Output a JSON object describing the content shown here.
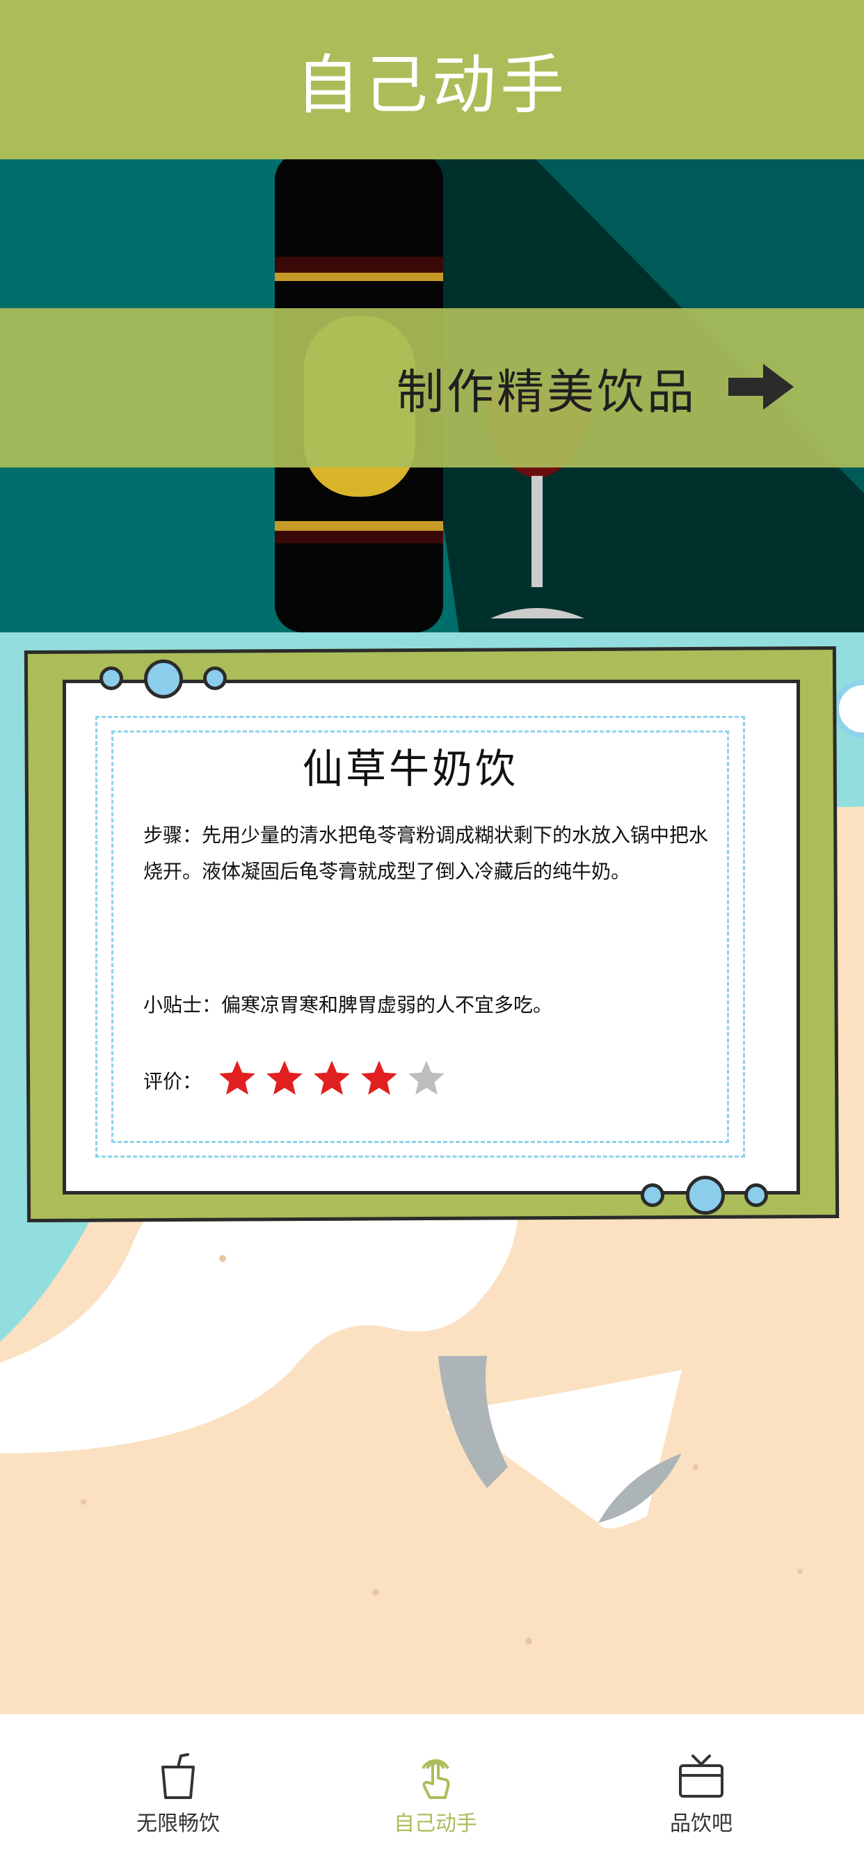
{
  "header": {
    "title": "自己动手"
  },
  "hero": {
    "text": "制作精美饮品",
    "arrow_icon": "arrow-right-icon"
  },
  "card": {
    "title": "仙草牛奶饮",
    "steps": "步骤：先用少量的清水把龟苓膏粉调成糊状剩下的水放入锅中把水烧开。液体凝固后龟苓膏就成型了倒入冷藏后的纯牛奶。",
    "tip": "小贴士：偏寒凉胃寒和脾胃虚弱的人不宜多吃。",
    "rating_label": "评价：",
    "rating": 4,
    "rating_max": 5
  },
  "tabbar": {
    "items": [
      {
        "label": "无限畅饮",
        "icon": "drink-cup-icon",
        "active": false
      },
      {
        "label": "自己动手",
        "icon": "hand-tap-icon",
        "active": true
      },
      {
        "label": "品饮吧",
        "icon": "tv-box-icon",
        "active": false
      }
    ]
  },
  "colors": {
    "accent": "#abbd59",
    "teal": "#006e6b",
    "star_on": "#e02020",
    "star_off": "#bdbdbd",
    "tab_active": "#abbd59",
    "tab_inactive": "#333333"
  }
}
